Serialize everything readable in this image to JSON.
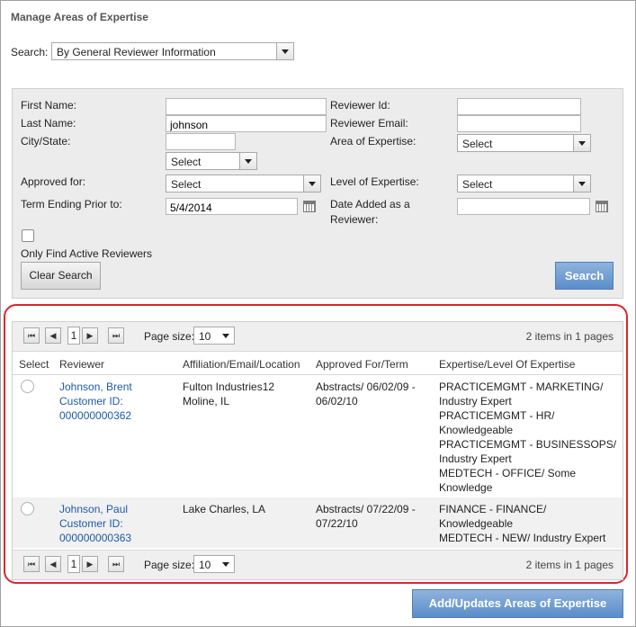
{
  "page": {
    "title": "Manage Areas of Expertise"
  },
  "search": {
    "label": "Search:",
    "mode": "By General Reviewer Information"
  },
  "form": {
    "first_name_label": "First Name:",
    "first_name_value": "",
    "last_name_label": "Last Name:",
    "last_name_value": "johnson",
    "city_state_label": "City/State:",
    "city_value": "",
    "state_value": "Select",
    "reviewer_id_label": "Reviewer Id:",
    "reviewer_id_value": "",
    "reviewer_email_label": "Reviewer Email:",
    "reviewer_email_value": "",
    "area_label": "Area of Expertise:",
    "area_value": "Select",
    "approved_for_label": "Approved for:",
    "approved_for_value": "Select",
    "level_label": "Level of Expertise:",
    "level_value": "Select",
    "term_label": "Term Ending Prior to:",
    "term_value": "5/4/2014",
    "date_added_label_1": "Date Added as a",
    "date_added_label_2": "Reviewer:",
    "date_added_value": "",
    "active_label": "Only Find Active Reviewers",
    "clear_label": "Clear Search",
    "search_label": "Search"
  },
  "pager": {
    "page": "1",
    "page_size_label": "Page size:",
    "page_size": "10",
    "summary": "2 items in 1 pages"
  },
  "columns": [
    "Select",
    "Reviewer",
    "Affiliation/Email/Location",
    "Approved For/Term",
    "Expertise/Level Of Expertise"
  ],
  "rows": [
    {
      "reviewer": [
        "Johnson, Brent",
        "Customer ID:",
        "000000000362"
      ],
      "affiliation": [
        "Fulton Industries12",
        "Moline, IL"
      ],
      "approved": [
        "Abstracts/ 06/02/09 -",
        "06/02/10"
      ],
      "expertise": [
        "PRACTICEMGMT - MARKETING/",
        "Industry Expert",
        "PRACTICEMGMT - HR/",
        "Knowledgeable",
        "PRACTICEMGMT - BUSINESSOPS/",
        "Industry Expert",
        "MEDTECH - OFFICE/ Some",
        "Knowledge"
      ]
    },
    {
      "reviewer": [
        "Johnson, Paul",
        "Customer ID:",
        "000000000363"
      ],
      "affiliation": [
        "Lake Charles, LA"
      ],
      "approved": [
        "Abstracts/ 07/22/09 -",
        "07/22/10"
      ],
      "expertise": [
        "FINANCE - FINANCE/",
        "Knowledgeable",
        "MEDTECH - NEW/ Industry Expert"
      ]
    }
  ],
  "footer": {
    "add_update_label": "Add/Updates Areas of Expertise"
  },
  "colors": {
    "accent_blue": "#5b8dc9",
    "link": "#1c5aa8",
    "highlight_border": "#d9262e",
    "panel": "#ececec"
  }
}
